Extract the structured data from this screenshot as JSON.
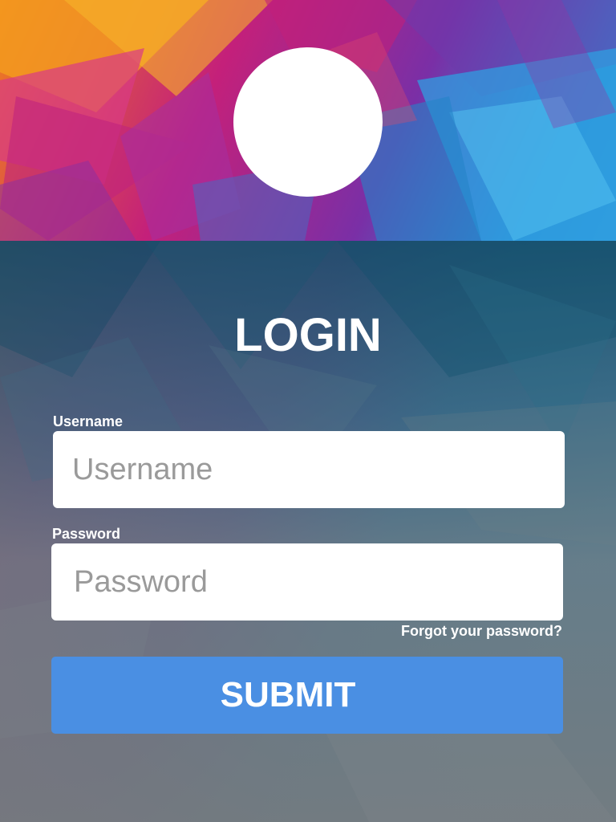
{
  "header": {
    "avatar_icon": "user-avatar-circle"
  },
  "login": {
    "title": "LOGIN",
    "username": {
      "label": "Username",
      "placeholder": "Username",
      "value": ""
    },
    "password": {
      "label": "Password",
      "placeholder": "Password",
      "value": ""
    },
    "forgot_link": "Forgot your password?",
    "submit_label": "SUBMIT"
  },
  "colors": {
    "submit_button": "#4a8fe3",
    "overlay": "#6f7478",
    "text": "#ffffff",
    "field_background": "#ffffff",
    "placeholder": "#9a9a9a"
  }
}
